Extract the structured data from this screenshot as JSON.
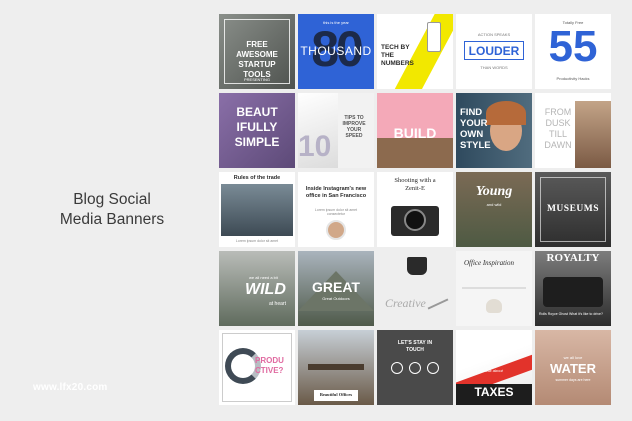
{
  "heading": {
    "line1": "Blog Social",
    "line2": "Media Banners"
  },
  "site": "www.lfx20.com",
  "tiles": {
    "r1c1": {
      "main": "FREE AWESOME STARTUP TOOLS",
      "small": "PRESENTING"
    },
    "r1c2": {
      "big": "80",
      "word": "THOUSAND",
      "small": "this is the year"
    },
    "r1c3": {
      "main": "TECH BY THE NUMBERS"
    },
    "r1c4": {
      "small_top": "ACTION SPEAKS",
      "main": "LOUDER",
      "small": "THAN WORDS"
    },
    "r1c5": {
      "small_top": "Totally Free",
      "big": "55",
      "small": "Productivity Hacks"
    },
    "r2c1": {
      "main1": "BEAUT",
      "main2": "IFULLY",
      "main3": "SIMPLE"
    },
    "r2c2": {
      "big": "10",
      "main": "TIPS TO IMPROVE YOUR SPEED"
    },
    "r2c3": {
      "main": "BUILD"
    },
    "r2c4": {
      "main": "FIND YOUR OWN STYLE"
    },
    "r2c5": {
      "main": "FROM DUSK TILL DAWN"
    },
    "r3c1": {
      "title": "Rules of the trade",
      "small": "Lorem ipsum dolor sit amet"
    },
    "r3c2": {
      "main": "Inside Instagram's new office in San Francisco",
      "small": "Lorem ipsum dolor sit amet consectetur"
    },
    "r3c3": {
      "main": "Shooting with a Zenit-E"
    },
    "r3c4": {
      "main": "Young",
      "small": "and wild"
    },
    "r3c5": {
      "main": "MUSEUMS"
    },
    "r4c1": {
      "small": "we all need a bit",
      "main": "WILD",
      "small2": "at heart"
    },
    "r4c2": {
      "main": "GREAT",
      "small": "Great Outdoors"
    },
    "r4c3": {
      "main": "Creative"
    },
    "r4c4": {
      "main": "Office Inspiration"
    },
    "r4c5": {
      "main": "ROYALTY",
      "small": "Rolls Royce Ghost What it's like to drive?"
    },
    "r5c1": {
      "main": "PRODU CTIVE?"
    },
    "r5c2": {
      "main": "Beautiful Offices"
    },
    "r5c3": {
      "main": "LET'S STAY IN TOUCH"
    },
    "r5c4": {
      "main": "TAXES",
      "small": "Let's talk about"
    },
    "r5c5": {
      "small": "we all love",
      "main": "WATER",
      "small2": "summer days are here"
    }
  },
  "colors": {
    "background": "#eeeeee",
    "blue": "#2f63d6",
    "yellow": "#f2e800",
    "pink": "#f4a9b8",
    "red": "#e2332b"
  }
}
